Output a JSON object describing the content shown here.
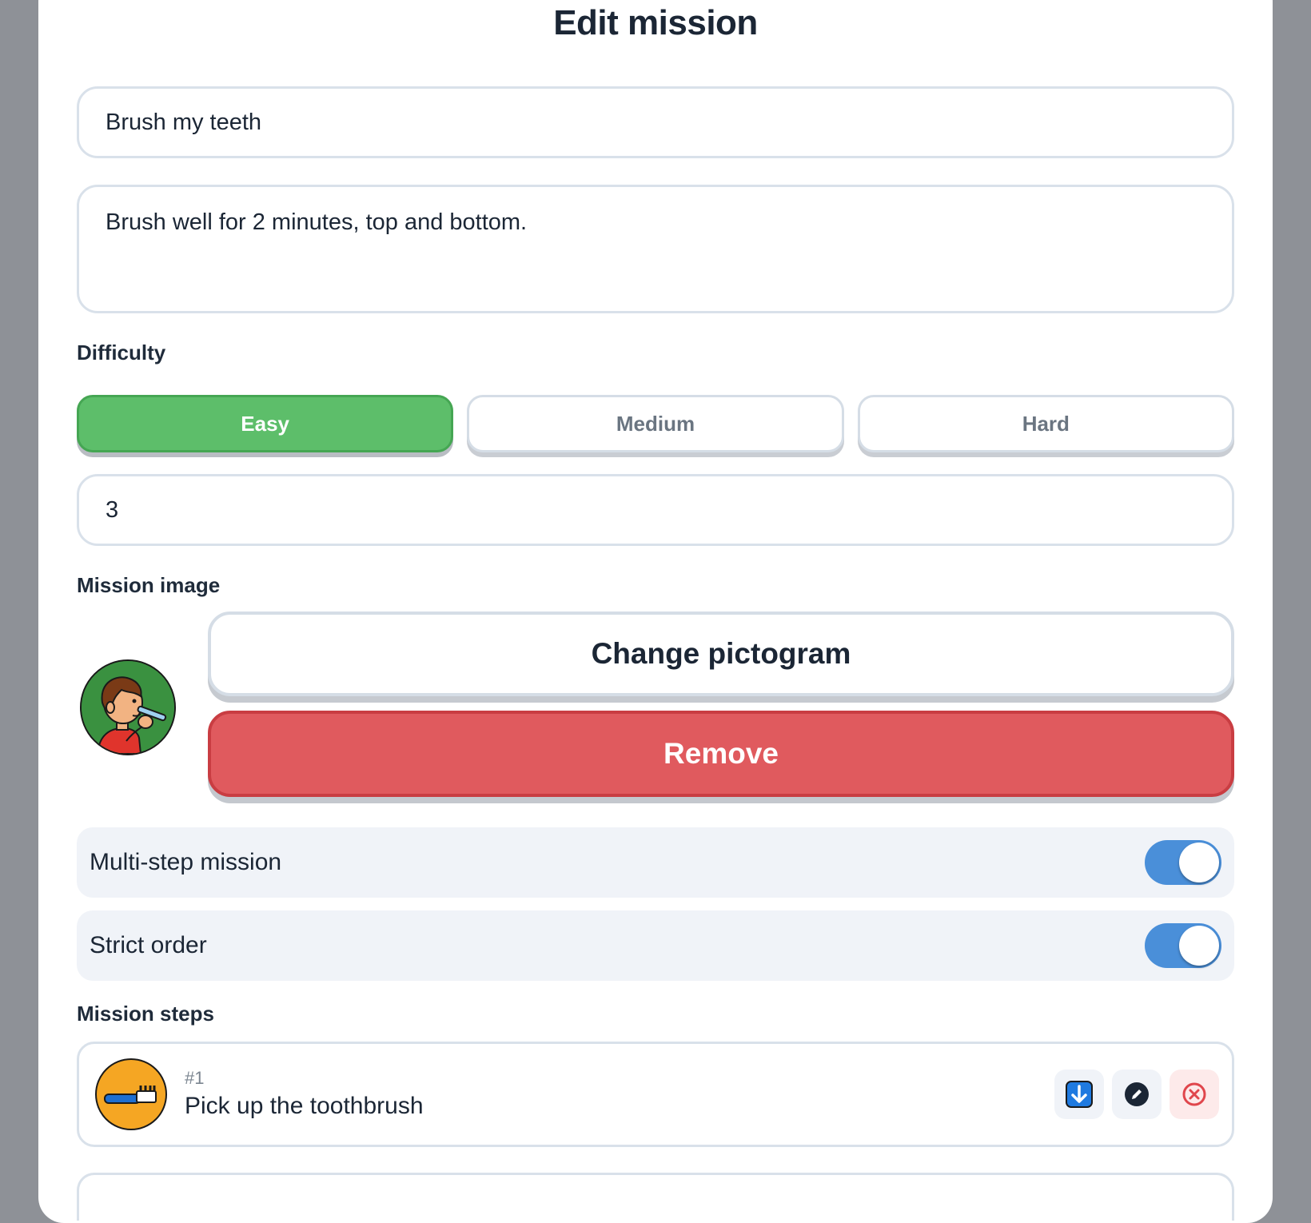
{
  "dialog": {
    "title": "Edit mission"
  },
  "form": {
    "name_value": "Brush my teeth",
    "description_value": "Brush well for 2 minutes, top and bottom.",
    "difficulty_label": "Difficulty",
    "difficulty_options": [
      {
        "label": "Easy",
        "selected": true
      },
      {
        "label": "Medium",
        "selected": false
      },
      {
        "label": "Hard",
        "selected": false
      }
    ],
    "points_value": "3",
    "image_label": "Mission image",
    "change_pictogram_label": "Change pictogram",
    "remove_label": "Remove",
    "multi_step_label": "Multi-step mission",
    "multi_step_on": true,
    "strict_order_label": "Strict order",
    "strict_order_on": true,
    "steps_label": "Mission steps"
  },
  "steps": [
    {
      "number": "#1",
      "label": "Pick up the toothbrush",
      "icon": "toothbrush-icon"
    }
  ],
  "colors": {
    "easy_green": "#5dbe6a",
    "remove_red": "#e05a5e",
    "toggle_blue": "#4a8fd9",
    "step_icon_orange": "#f5a623"
  }
}
